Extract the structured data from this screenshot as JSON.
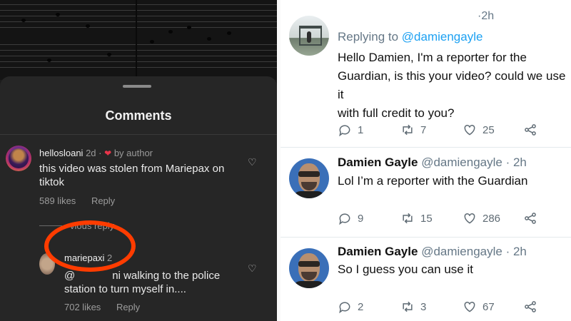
{
  "left": {
    "panel_title": "Comments",
    "comments": [
      {
        "username": "hellosloani",
        "time": "2d",
        "by_author": "by author",
        "text_line1": "this video was stolen from Mariepax on",
        "text_line2": "tiktok",
        "likes": "589 likes",
        "reply_label": "Reply"
      }
    ],
    "view_replies": "View previous reply",
    "view_replies_visible": "vious reply",
    "reply": {
      "username": "mariepaxi",
      "time": "2",
      "text_line1_visible": "@",
      "text_line1_rest": "ni walking to the police",
      "text_line2": "station to turn myself in....",
      "likes": "702 likes",
      "reply_label": "Reply"
    },
    "annotation_color": "#ff3c00"
  },
  "right": {
    "tweets": [
      {
        "time": "·2h",
        "replying_prefix": "Replying to ",
        "replying_handle": "@damiengayle",
        "line1": "Hello Damien, I'm a reporter for the",
        "line2": "Guardian, is this your video? could we use it",
        "line3": "with full credit to you?",
        "replies": "1",
        "retweets": "7",
        "likes": "25"
      },
      {
        "name": "Damien Gayle",
        "handle": "@damiengayle",
        "time": "· 2h",
        "line1": "Lol I’m a reporter with the Guardian",
        "replies": "9",
        "retweets": "15",
        "likes": "286"
      },
      {
        "name": "Damien Gayle",
        "handle": "@damiengayle",
        "time": "· 2h",
        "line1": "So I guess you can use it",
        "replies": "2",
        "retweets": "3",
        "likes": "67"
      }
    ],
    "link_color": "#1da1f2"
  }
}
